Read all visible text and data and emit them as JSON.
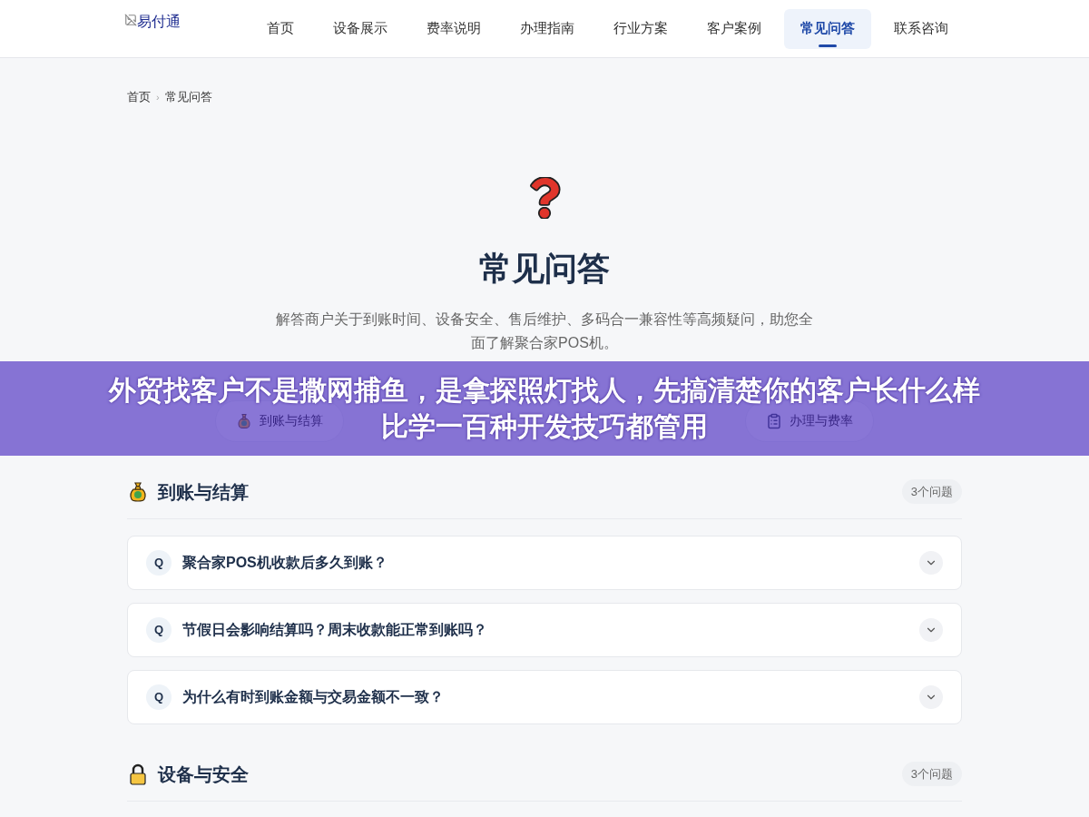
{
  "logo": {
    "alt": "易付通"
  },
  "nav": [
    {
      "label": "首页",
      "selected": false
    },
    {
      "label": "设备展示",
      "selected": false
    },
    {
      "label": "费率说明",
      "selected": false
    },
    {
      "label": "办理指南",
      "selected": false
    },
    {
      "label": "行业方案",
      "selected": false
    },
    {
      "label": "客户案例",
      "selected": false
    },
    {
      "label": "常见问答",
      "selected": true
    },
    {
      "label": "联系咨询",
      "selected": false
    }
  ],
  "breadcrumb": {
    "items": [
      "首页",
      "常见问答"
    ],
    "separator": "›"
  },
  "hero": {
    "title": "常见问答",
    "description": "解答商户关于到账时间、设备安全、售后维护、多码合一兼容性等高频疑问，助您全面了解聚合家POS机。"
  },
  "category_tabs": [
    {
      "kind": "money",
      "label": "到账与结算"
    },
    {
      "kind": "document",
      "label": "办理与费率"
    }
  ],
  "banner": {
    "lines": [
      "外贸找客户不是撒网捕鱼，是拿探照灯找人，先搞清楚你的客户长什么样",
      "比学一百种开发技巧都管用"
    ]
  },
  "sections": [
    {
      "kind": "money",
      "title": "到账与结算",
      "count": "3个问题",
      "questions": [
        {
          "badge": "Q",
          "text": "聚合家POS机收款后多久到账？",
          "expanded": false
        },
        {
          "badge": "Q",
          "text": "节假日会影响结算吗？周末收款能正常到账吗？",
          "expanded": false
        },
        {
          "badge": "Q",
          "text": "为什么有时到账金额与交易金额不一致？",
          "expanded": false
        }
      ]
    },
    {
      "kind": "lock",
      "title": "设备与安全",
      "count": "3个问题"
    }
  ]
}
